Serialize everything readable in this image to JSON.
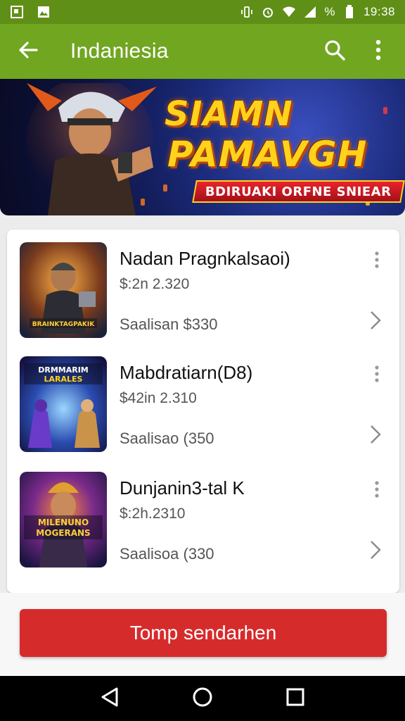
{
  "status_bar": {
    "time": "19:38",
    "battery": "%",
    "icons": [
      "screenshot-icon",
      "image-icon",
      "vibrate-icon",
      "alarm-icon",
      "wifi-icon",
      "signal-icon",
      "battery-icon"
    ]
  },
  "app_bar": {
    "title": "Indaniesia",
    "icons": [
      "back-arrow-icon",
      "search-icon",
      "overflow-menu-icon"
    ]
  },
  "banner": {
    "title_line1": "SIAMN",
    "title_line2": "PAMAVGH",
    "ribbon_text": "BDIRUAKI ORFNE SNIEAR"
  },
  "items": [
    {
      "name": "Nadan Pragnkalsaoi)",
      "price": "$:2n 2.320",
      "sale": "Saalisan $330",
      "thumb_text": "BRAINKTAGPAKIK"
    },
    {
      "name": "Mabdratiarn(D8)",
      "price": "$42in 2.310",
      "sale": "Saalisao (350",
      "thumb_text": "DRMMARIM LARALES"
    },
    {
      "name": "Dunjanin3-tal K",
      "price": "$:2h.2310",
      "sale": "Saalisoa (330",
      "thumb_text": "MILENUNO MOGERANS"
    }
  ],
  "cta": {
    "label": "Tomp sendarhen"
  },
  "colors": {
    "status_bar": "#5f8f17",
    "app_bar": "#71a621",
    "cta": "#d62b2b",
    "nav": "#000000"
  }
}
